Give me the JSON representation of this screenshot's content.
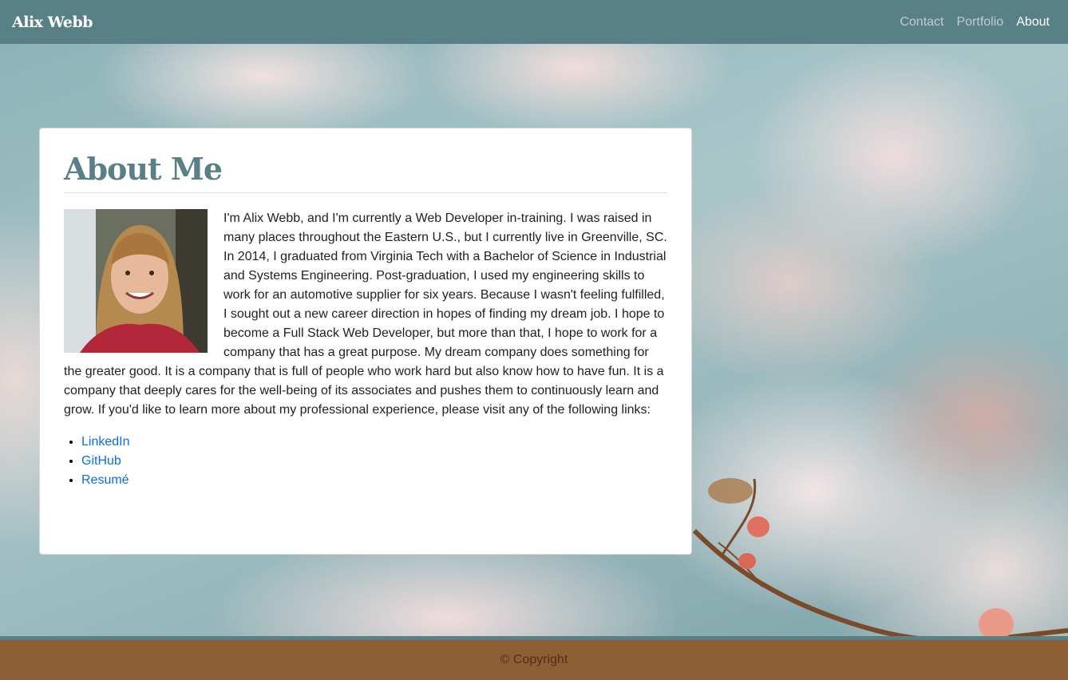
{
  "navbar": {
    "brand": "Alix Webb",
    "links": [
      "Contact",
      "Portfolio",
      "About"
    ],
    "active": "About"
  },
  "about": {
    "heading": "About Me",
    "bio": "I'm Alix Webb, and I'm currently a Web Developer in-training. I was raised in many places throughout the Eastern U.S., but I currently live in Greenville, SC. In 2014, I graduated from Virginia Tech with a Bachelor of Science in Industrial and Systems Engineering. Post-graduation, I used my engineering skills to work for an automotive supplier for six years. Because I wasn't feeling fulfilled, I sought out a new career direction in hopes of finding my dream job. I hope to become a Full Stack Web Developer, but more than that, I hope to work for a company that has a great purpose. My dream company does something for the greater good. It is a company that is full of people who work hard but also know how to have fun. It is a company that deeply cares for the well-being of its associates and pushes them to continuously learn and grow. If you'd like to learn more about my professional experience, please visit any of the following links:",
    "links": [
      "LinkedIn",
      "GitHub",
      "Resumé"
    ]
  },
  "footer": {
    "copyright": "© Copyright"
  },
  "colors": {
    "navbar": "#5a8087",
    "heading": "#5a8087",
    "link": "#0a6de0",
    "footer": "#8e5e35"
  },
  "icons": {
    "profile_photo": "profile-photo"
  }
}
